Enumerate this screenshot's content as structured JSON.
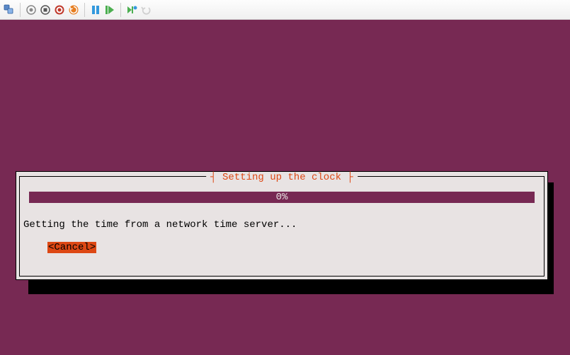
{
  "toolbar": {
    "icons": {
      "vm": "vm-icon",
      "snapshot": "snapshot-icon",
      "stop": "stop-icon",
      "power": "power-icon",
      "restart": "restart-icon",
      "pause": "pause-icon",
      "play": "play-icon",
      "skip": "skip-icon",
      "undo": "undo-icon"
    }
  },
  "dialog": {
    "title_raw": "┤ Setting up the clock ├",
    "title": "Setting up the clock",
    "progress_percent": "0%",
    "status": "Getting the time from a network time server...",
    "cancel_label": "<Cancel>"
  },
  "colors": {
    "background": "#772953",
    "dialog_bg": "#e8e3e3",
    "accent": "#dd4814"
  }
}
